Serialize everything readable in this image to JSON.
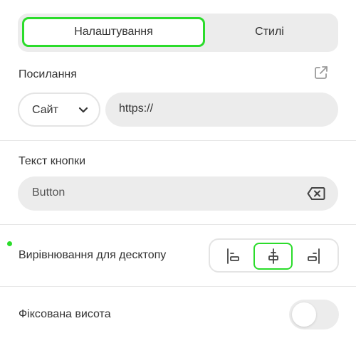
{
  "tabs": [
    {
      "label": "Налаштування",
      "active": true
    },
    {
      "label": "Стилі",
      "active": false
    }
  ],
  "link": {
    "label": "Посилання",
    "type_select": {
      "value": "Сайт"
    },
    "url_value": "https://"
  },
  "button_text": {
    "label": "Текст кнопки",
    "value": "Button"
  },
  "alignment": {
    "label": "Вирівнювання для десктопу",
    "options": [
      "left",
      "center",
      "right"
    ],
    "selected": "center"
  },
  "fixed_height": {
    "label": "Фіксована висота",
    "enabled": false
  },
  "colors": {
    "accent": "#2bdc2b",
    "field_bg": "#ececec",
    "text": "#333333",
    "icon": "#9a9a9a"
  }
}
